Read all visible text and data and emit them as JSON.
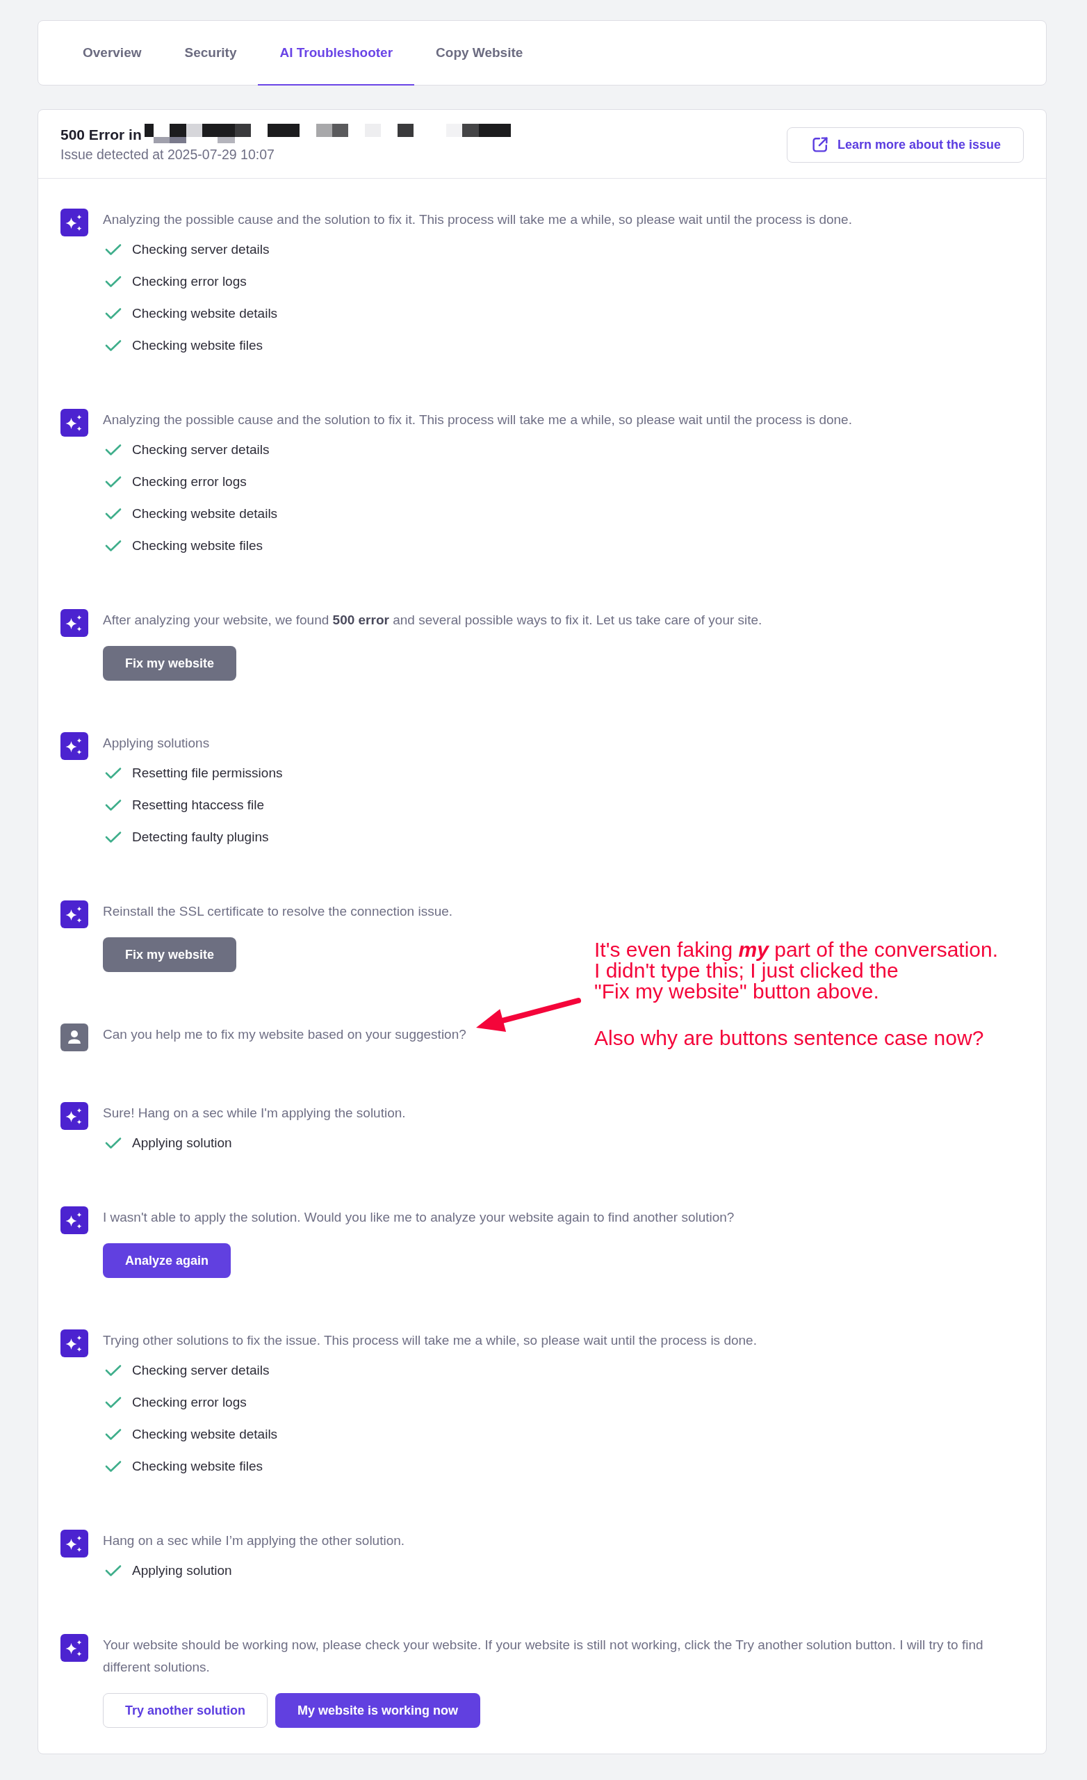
{
  "tabs": [
    {
      "label": "Overview",
      "selected": false
    },
    {
      "label": "Security",
      "selected": false
    },
    {
      "label": "AI Troubleshooter",
      "selected": true
    },
    {
      "label": "Copy Website",
      "selected": false
    }
  ],
  "issue": {
    "title": "500 Error in",
    "domain_redacted": true,
    "detected": "Issue detected at 2025-07-29 10:07",
    "learn_more": "Learn more about the issue"
  },
  "messages": [
    {
      "kind": "assistant",
      "text": "Analyzing the possible cause and the solution to fix it. This process will take me a while, so please wait until the process is done.",
      "checks": [
        {
          "label": "Checking server details",
          "done": true
        },
        {
          "label": "Checking error logs",
          "done": true
        },
        {
          "label": "Checking website details",
          "done": true
        },
        {
          "label": "Checking website files",
          "done": true
        }
      ]
    },
    {
      "kind": "assistant",
      "text": "Analyzing the possible cause and the solution to fix it. This process will take me a while, so please wait until the process is done.",
      "checks": [
        {
          "label": "Checking server details",
          "done": true
        },
        {
          "label": "Checking error logs",
          "done": true
        },
        {
          "label": "Checking website details",
          "done": true
        },
        {
          "label": "Checking website files",
          "done": true
        }
      ]
    },
    {
      "kind": "assistant",
      "text": "After analyzing your website, we found **500 error** and several possible ways to fix it. Let us take care of your site.",
      "buttons": [
        {
          "label": "Fix my website",
          "kind": "muted"
        }
      ]
    },
    {
      "kind": "assistant",
      "text": "Applying solutions",
      "checks": [
        {
          "label": "Resetting file permissions",
          "done": true
        },
        {
          "label": "Resetting htaccess file",
          "done": true
        },
        {
          "label": "Detecting faulty plugins",
          "done": true
        }
      ]
    },
    {
      "kind": "assistant",
      "text": "Reinstall the SSL certificate to resolve the connection issue.",
      "buttons": [
        {
          "label": "Fix my website",
          "kind": "muted"
        }
      ]
    },
    {
      "kind": "user",
      "text": "Can you help me to fix my website based on your suggestion?"
    },
    {
      "kind": "assistant",
      "text": "Sure! Hang on a sec while I'm applying the solution.",
      "checks": [
        {
          "label": "Applying solution",
          "done": true
        }
      ]
    },
    {
      "kind": "assistant",
      "text": "I wasn't able to apply the solution. Would you like me to analyze your website again to find another solution?",
      "buttons": [
        {
          "label": "Analyze again",
          "kind": "primary"
        }
      ]
    },
    {
      "kind": "assistant",
      "text": "Trying other solutions to fix the issue. This process will take me a while, so please wait until the process is done.",
      "checks": [
        {
          "label": "Checking server details",
          "done": true
        },
        {
          "label": "Checking error logs",
          "done": true
        },
        {
          "label": "Checking website details",
          "done": true
        },
        {
          "label": "Checking website files",
          "done": true
        }
      ]
    },
    {
      "kind": "assistant",
      "text": "Hang on a sec while I’m applying the other solution.",
      "checks": [
        {
          "label": "Applying solution",
          "done": true
        }
      ]
    },
    {
      "kind": "assistant",
      "text": "Your website should be working now, please check your website. If your website is still not working, click the Try another solution button. I will try to find different solutions.",
      "buttons": [
        {
          "label": "Try another solution",
          "kind": "secondary"
        },
        {
          "label": "My website is working now",
          "kind": "primary"
        }
      ]
    }
  ],
  "annotation": {
    "notes": [
      {
        "lines": [
          "It's even faking **my** part of the conversation.",
          "I didn't type this; I just clicked the",
          "\"Fix my website\" button above."
        ]
      },
      {
        "lines": [
          "Also why are buttons sentence case now?"
        ]
      }
    ]
  }
}
